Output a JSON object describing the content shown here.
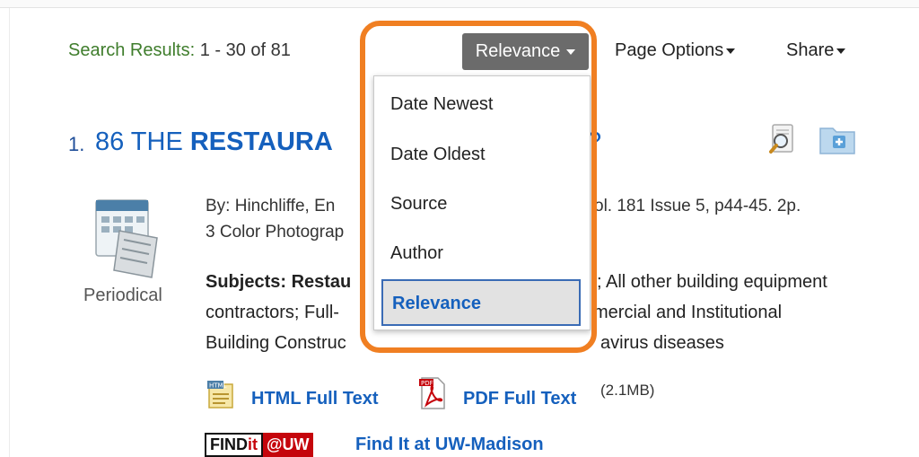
{
  "header": {
    "results_label": "Search Results:",
    "results_count": "1 - 30 of 81",
    "sort_label": "Relevance",
    "page_options_label": "Page Options",
    "share_label": "Share"
  },
  "sort_dropdown": {
    "options": [
      "Date Newest",
      "Date Oldest",
      "Source",
      "Author",
      "Relevance"
    ],
    "selected": "Relevance"
  },
  "result": {
    "number": "1.",
    "title_prefix": "86 THE ",
    "title_bold": "RESTAURA",
    "title_tail": "?",
    "pub_type": "Periodical",
    "byline_1_a": "By: Hinchliffe, En",
    "byline_1_b": "ol. 181 Issue 5, p44-45. 2p.",
    "byline_2": "3 Color Photograp",
    "subjects_label": "Subjects: Restau",
    "subjects_1_b": "; All other building equipment",
    "subjects_2_a": "contractors; Full-",
    "subjects_2_b": "mercial and Institutional",
    "subjects_3": "Building Construc",
    "subjects_3_b": "avirus diseases",
    "html_link": "HTML Full Text",
    "pdf_link": "PDF Full Text",
    "pdf_size": "(2.1MB)",
    "findit_logo_a": "FIND",
    "findit_logo_b": "it",
    "findit_logo_c": "@UW",
    "findit_link": "Find It at UW-Madison"
  },
  "icons": {
    "preview": "preview-magnifier-icon",
    "folder": "add-to-folder-icon",
    "html": "html-document-icon",
    "pdf": "pdf-document-icon",
    "periodical": "periodical-icon"
  },
  "colors": {
    "highlight": "#f07f22",
    "link": "#1560bd",
    "results_label": "#3f7d2c",
    "sort_button": "#6b6b6b"
  }
}
